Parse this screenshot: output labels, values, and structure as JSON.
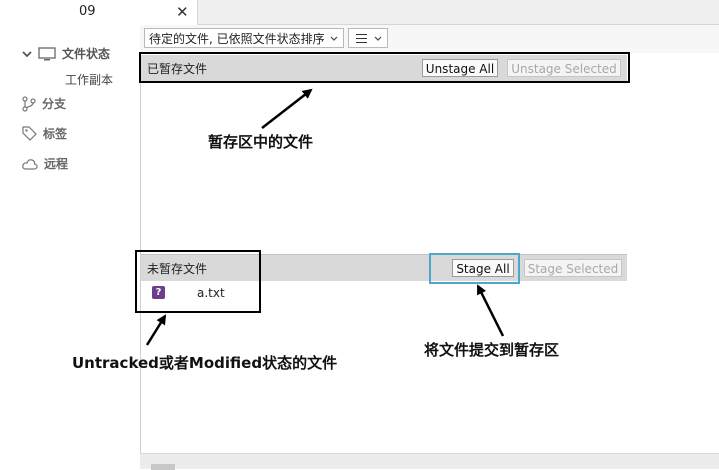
{
  "tab": {
    "title": "09",
    "close_glyph": "✕"
  },
  "sidebar": {
    "items": [
      {
        "label": "文件状态",
        "icon": "monitor-icon",
        "expanded": true
      },
      {
        "label": "分支",
        "icon": "branch-icon"
      },
      {
        "label": "标签",
        "icon": "tag-icon"
      },
      {
        "label": "远程",
        "icon": "cloud-icon"
      }
    ],
    "subitem": "工作副本",
    "chevron": "chevron-down-icon"
  },
  "toolbar": {
    "sort_value": "待定的文件, 已依照文件状态排序",
    "view_icon": "list-view-icon"
  },
  "staged": {
    "title": "已暂存文件",
    "unstage_all": "Unstage All",
    "unstage_selected": "Unstage Selected"
  },
  "unstaged": {
    "title": "未暂存文件",
    "stage_all": "Stage All",
    "stage_selected": "Stage Selected",
    "files": [
      {
        "name": "a.txt",
        "status_glyph": "?",
        "status_color": "#6b3f8c"
      }
    ]
  },
  "annotations": {
    "staged_area": "暂存区中的文件",
    "untracked": "Untracked或者Modified状态的文件",
    "stage_action": "将文件提交到暂存区"
  },
  "colors": {
    "header_bg": "#d9d9d9",
    "highlight_box": "#4aa8c8",
    "annotation_box": "#000000"
  }
}
